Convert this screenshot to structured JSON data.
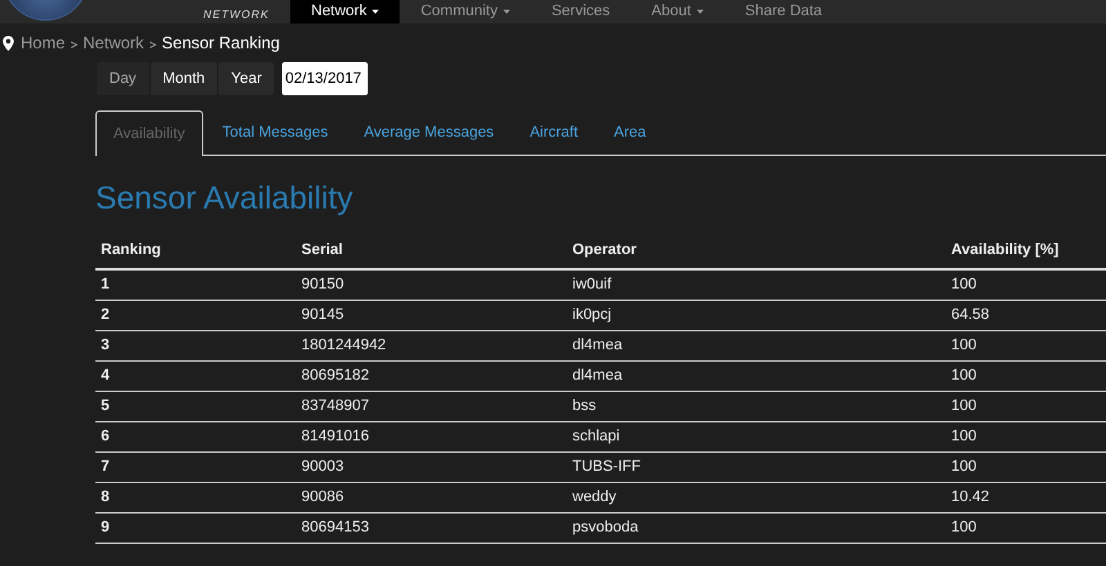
{
  "logo": {
    "text": "NETWORK"
  },
  "nav": [
    {
      "label": "Network",
      "selected": true,
      "dropdown": true
    },
    {
      "label": "Community",
      "selected": false,
      "dropdown": true
    },
    {
      "label": "Services",
      "selected": false,
      "dropdown": false
    },
    {
      "label": "About",
      "selected": false,
      "dropdown": true
    },
    {
      "label": "Share Data",
      "selected": false,
      "dropdown": false
    }
  ],
  "breadcrumb": [
    "Home",
    "Network",
    "Sensor Ranking"
  ],
  "period_buttons": [
    {
      "label": "Day",
      "selected": true
    },
    {
      "label": "Month",
      "selected": false
    },
    {
      "label": "Year",
      "selected": false
    }
  ],
  "date_field": {
    "value": "02/13/2017"
  },
  "tabs": [
    {
      "label": "Availability",
      "selected": true
    },
    {
      "label": "Total Messages",
      "selected": false
    },
    {
      "label": "Average Messages",
      "selected": false
    },
    {
      "label": "Aircraft",
      "selected": false
    },
    {
      "label": "Area",
      "selected": false
    }
  ],
  "heading": "Sensor Availability",
  "table": {
    "columns": [
      "Ranking",
      "Serial",
      "Operator",
      "Availability [%]"
    ],
    "rows": [
      [
        "1",
        "90150",
        "iw0uif",
        "100"
      ],
      [
        "2",
        "90145",
        "ik0pcj",
        "64.58"
      ],
      [
        "3",
        "1801244942",
        "dl4mea",
        "100"
      ],
      [
        "4",
        "80695182",
        "dl4mea",
        "100"
      ],
      [
        "5",
        "83748907",
        "bss",
        "100"
      ],
      [
        "6",
        "81491016",
        "schlapi",
        "100"
      ],
      [
        "7",
        "90003",
        "TUBS-IFF",
        "100"
      ],
      [
        "8",
        "90086",
        "weddy",
        "10.42"
      ],
      [
        "9",
        "80694153",
        "psvoboda",
        "100"
      ]
    ]
  }
}
